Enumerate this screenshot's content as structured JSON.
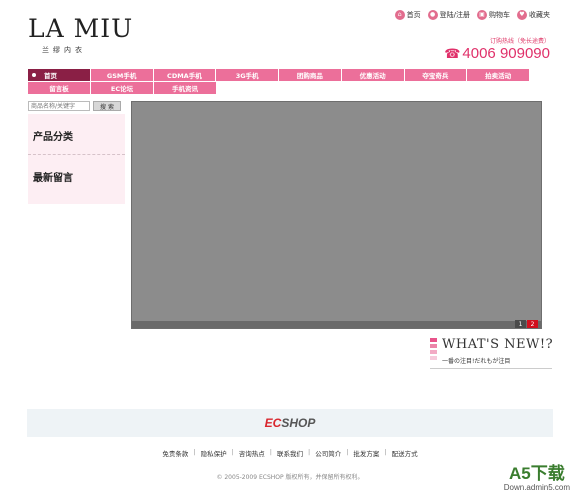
{
  "logo": {
    "main": "LA MIU",
    "sub": "兰缪内衣"
  },
  "top_links": [
    {
      "label": "首页",
      "icon": "home-icon"
    },
    {
      "label": "登陆/注册",
      "icon": "user-icon"
    },
    {
      "label": "购物车",
      "icon": "cart-icon"
    },
    {
      "label": "收藏夹",
      "icon": "favorite-icon"
    }
  ],
  "hotline": {
    "label": "订购热线（免长途费）",
    "phone_icon": "☎",
    "number": "4006 909090"
  },
  "nav": {
    "row1": [
      "首页",
      "GSM手机",
      "CDMA手机",
      "3G手机",
      "团购商品",
      "优惠活动",
      "夺宝奇兵",
      "拍卖活动"
    ],
    "row2": [
      "留言板",
      "EC论坛",
      "手机资讯"
    ]
  },
  "search": {
    "placeholder": "商品名称/关键字",
    "button": "搜 索"
  },
  "sidebar": {
    "category_title": "产品分类",
    "messages_title": "最新留言"
  },
  "banner": {
    "pages": [
      "1",
      "2"
    ],
    "active_page": "2"
  },
  "whatsnew": {
    "title": "WHAT'S NEW!?",
    "subtitle": "一番の注目!だれもが注目"
  },
  "footer": {
    "brand": "ECSHOP",
    "links": [
      "免责条款",
      "隐私保护",
      "咨询热点",
      "联系我们",
      "公司简介",
      "批发方案",
      "配送方式"
    ],
    "copyright": "© 2005-2009 ECSHOP 版权所有，并保留所有权利。"
  },
  "watermark": {
    "main": "A5下载",
    "url": "Down.admin5.com"
  },
  "colors": {
    "nav_pink": "#ec6f9a",
    "nav_active": "#8a1f45",
    "banner_gray": "#8c8c8c",
    "hotline": "#e0306a"
  }
}
